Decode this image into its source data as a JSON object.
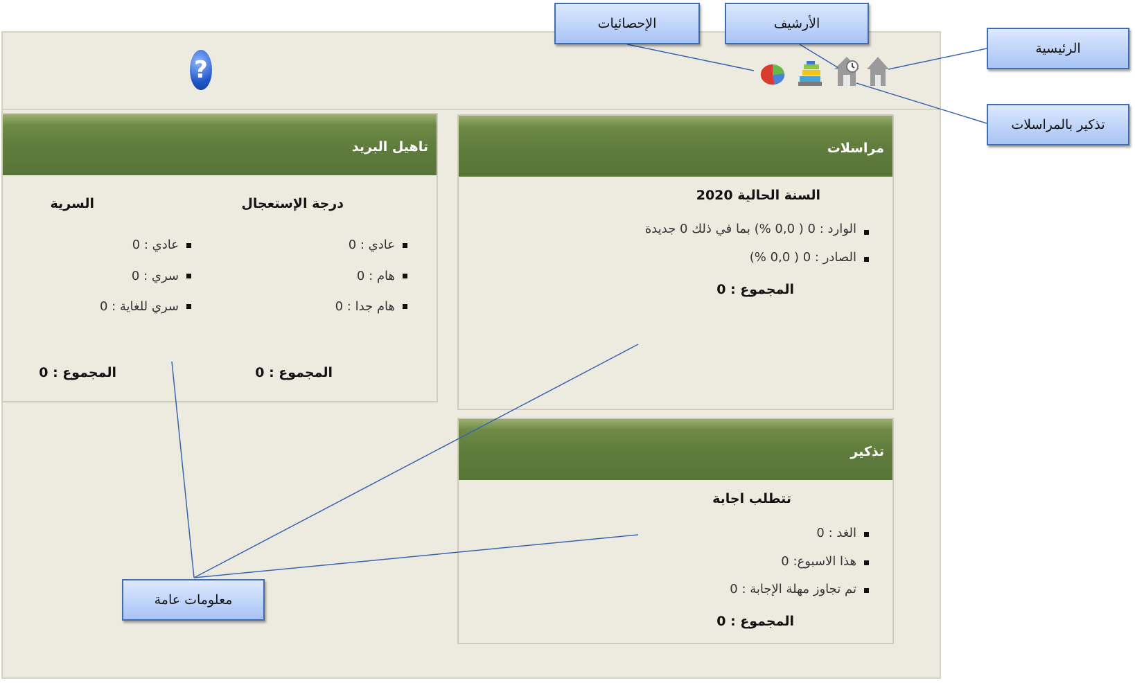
{
  "toolbar": {
    "icons": [
      "home-icon",
      "reminder-home-icon",
      "archive-icon",
      "statistics-icon",
      "help-icon"
    ],
    "help_glyph": "?"
  },
  "panels": {
    "correspondence": {
      "title": "مراسلات",
      "year_label": "السنة الحالية 2020",
      "incoming": "الوارد : 0 ( 0,0 %) بما في ذلك 0 جديدة",
      "outgoing": "الصادر : 0 ( 0,0 %)",
      "total": "المجموع : 0"
    },
    "mail_qualification": {
      "title": "تاهيل البريد",
      "urgency": {
        "heading": "درجة الإستعجال",
        "items": [
          "عادي : 0",
          "هام : 0",
          "هام جدا : 0"
        ],
        "total": "المجموع : 0"
      },
      "confidentiality": {
        "heading": "السرية",
        "items": [
          "عادي : 0",
          "سري : 0",
          "سري للغاية : 0"
        ],
        "total": "المجموع : 0"
      }
    },
    "reminder": {
      "title": "تذكير",
      "subtitle": "تتطلب اجابة",
      "items": [
        "الغد : 0",
        "هذا الاسبوع: 0",
        "تم تجاوز مهلة الإجابة : 0"
      ],
      "total": "المجموع : 0"
    }
  },
  "callouts": {
    "statistics": "الإحصائيات",
    "archive": "الأرشيف",
    "home": "الرئيسية",
    "reminder": "تذكير بالمراسلات",
    "general_info": "معلومات عامة"
  },
  "colors": {
    "panel_header": "#5e7a3c",
    "background": "#edeae0",
    "callout_border": "#3f6db2",
    "leader_line": "#3a64b0"
  }
}
